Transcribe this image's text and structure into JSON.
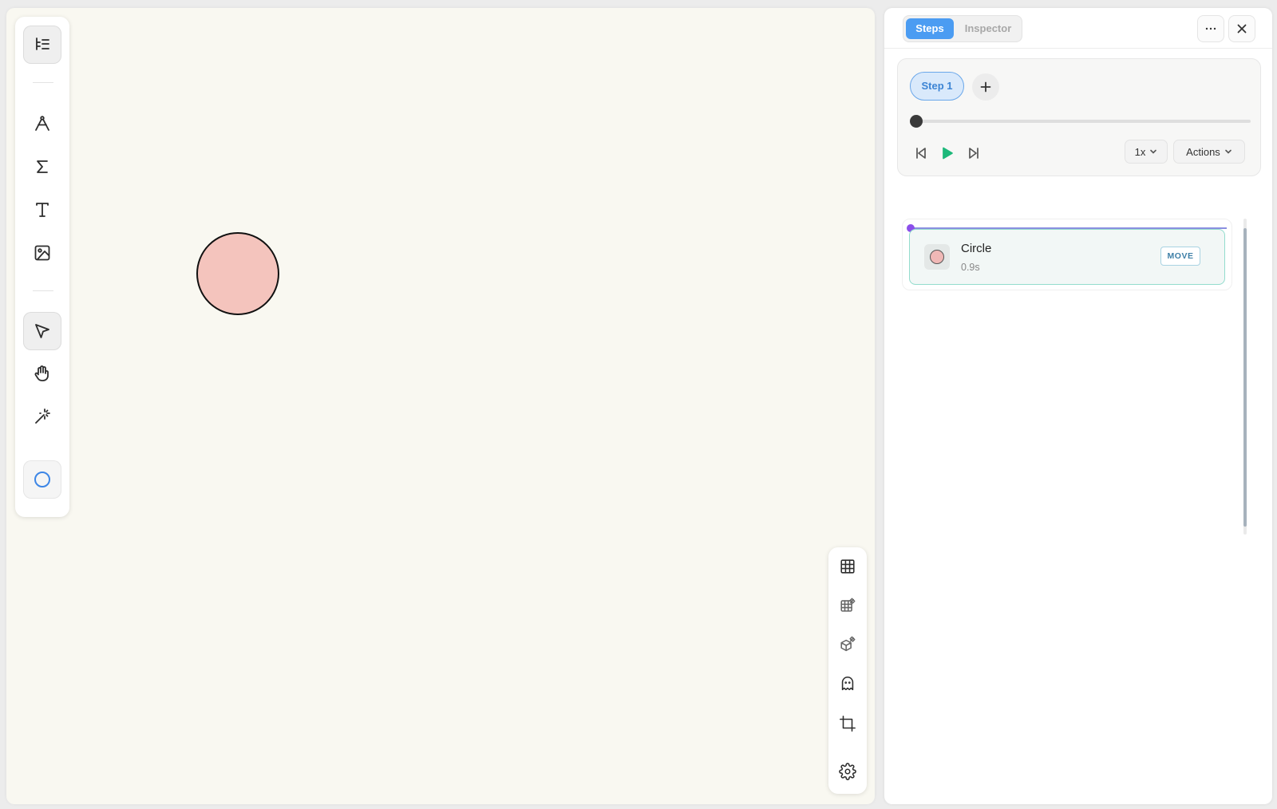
{
  "panel": {
    "tabs": [
      {
        "label": "Steps",
        "active": true
      },
      {
        "label": "Inspector",
        "active": false
      }
    ],
    "more_icon": "more-horizontal-icon",
    "close_icon": "close-icon"
  },
  "player": {
    "step_label": "Step 1",
    "add_step_icon": "plus-icon",
    "progress": 0,
    "speed": "1x",
    "actions_label": "Actions"
  },
  "timeline": {
    "items": [
      {
        "name": "Circle",
        "duration": "0.9s",
        "badge": "MOVE"
      }
    ]
  },
  "colors": {
    "accent": "#4b9cf2",
    "play": "#1db87a",
    "circle_fill": "#f4c4bd",
    "timeline_dot": "#8b4fea"
  },
  "left_toolbar": {
    "tools": [
      "tree-list-icon",
      "pen-tool-icon",
      "sigma-icon",
      "text-icon",
      "image-icon",
      "select-arrow-icon",
      "hand-icon",
      "magic-wand-icon",
      "circle-shape-icon"
    ],
    "active": "select-arrow-icon"
  },
  "right_toolbar": {
    "tools": [
      "grid-icon",
      "grid-snap-icon",
      "cube-snap-icon",
      "ghost-icon",
      "crop-icon",
      "settings-icon"
    ]
  }
}
